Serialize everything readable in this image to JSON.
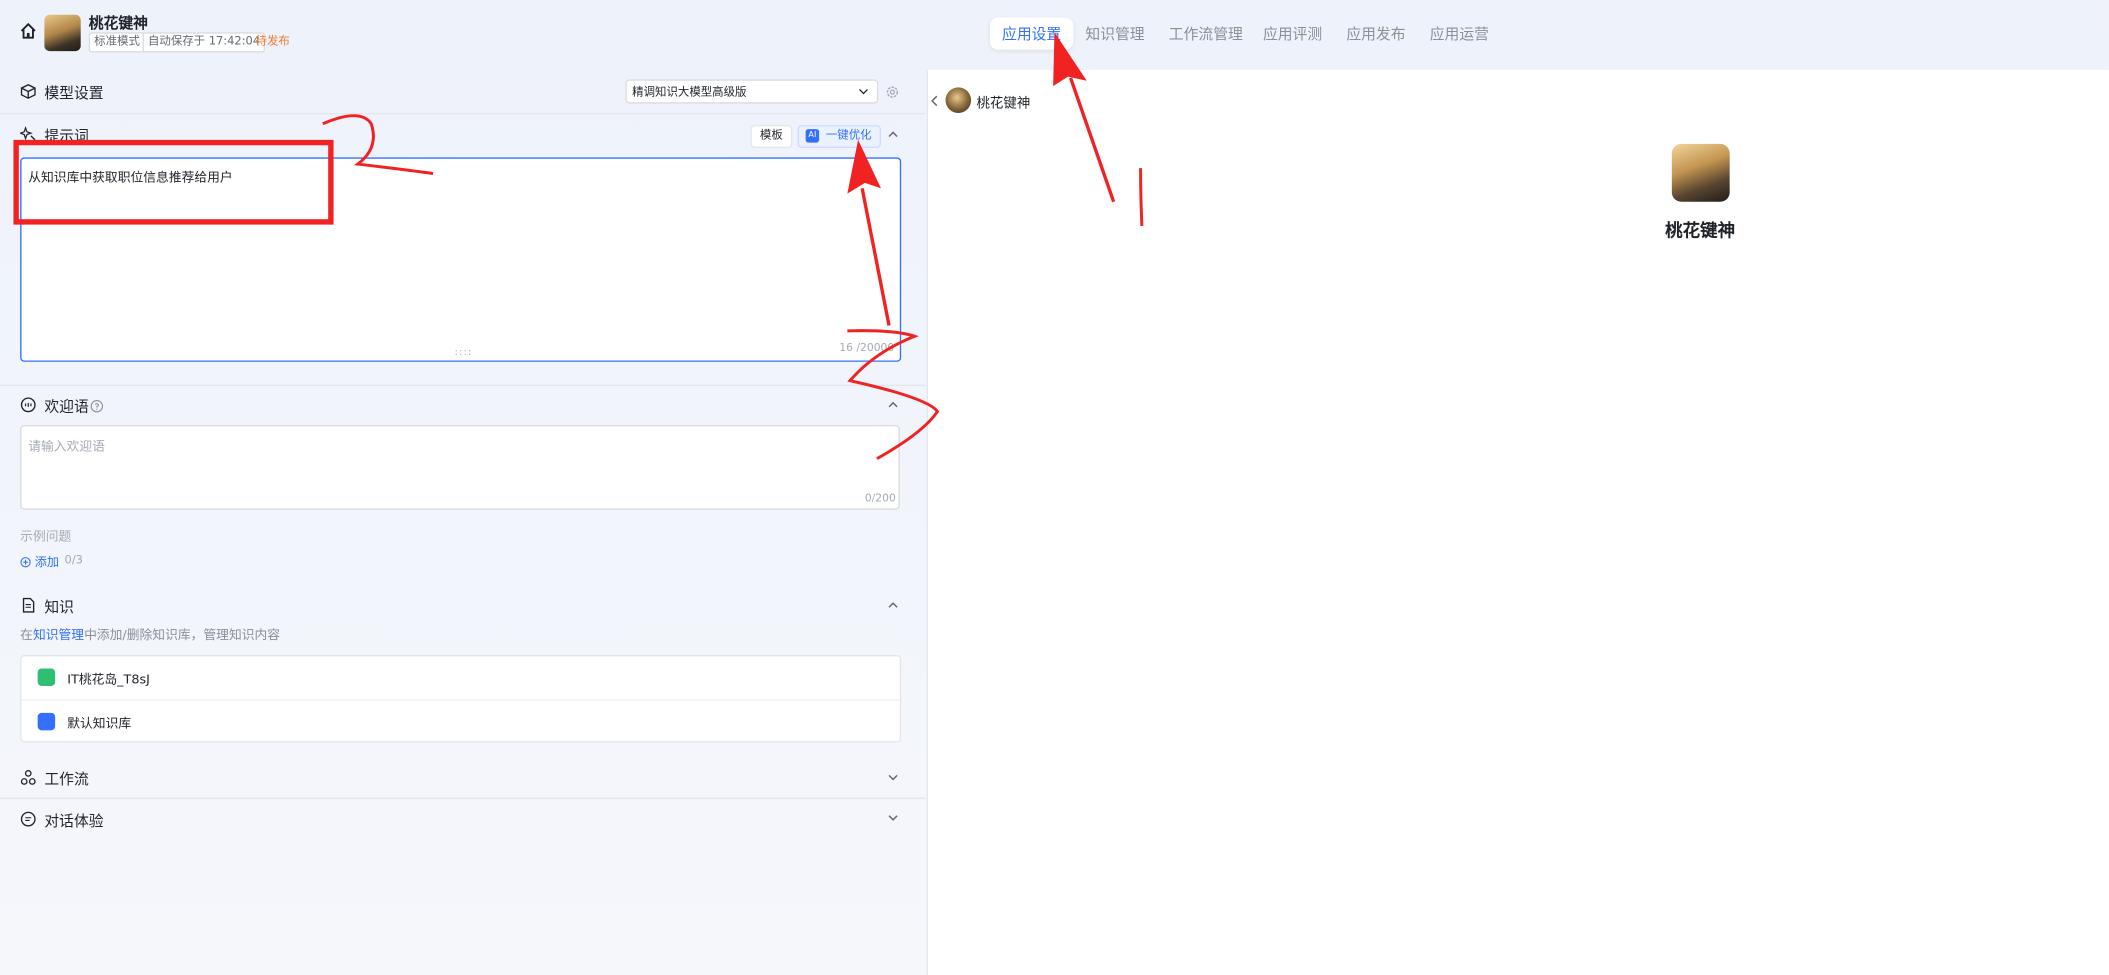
{
  "header": {
    "app_title": "桃花键神",
    "tag_mode": "标准模式",
    "tag_saved": "自动保存于 17:42:04",
    "tag_status": "待发布",
    "tabs": [
      {
        "label": "应用设置",
        "active": true
      },
      {
        "label": "知识管理",
        "active": false
      },
      {
        "label": "工作流管理",
        "active": false
      },
      {
        "label": "应用评测",
        "active": false
      },
      {
        "label": "应用发布",
        "active": false
      },
      {
        "label": "应用运营",
        "active": false
      }
    ]
  },
  "model": {
    "section_label": "模型设置",
    "selected": "精调知识大模型高级版"
  },
  "prompt": {
    "section_label": "提示词",
    "template_label": "模板",
    "optimize_label": "一键优化",
    "ai_badge": "AI",
    "value": "从知识库中获取职位信息推荐给用户",
    "count": "16 /20000"
  },
  "welcome": {
    "section_label": "欢迎语",
    "placeholder": "请输入欢迎语",
    "count": "0/200"
  },
  "examples": {
    "label": "示例问题",
    "add_label": "添加",
    "count": "0/3"
  },
  "knowledge": {
    "section_label": "知识",
    "desc_prefix": "在",
    "desc_link": "知识管理",
    "desc_suffix": "中添加/删除知识库，管理知识内容",
    "items": [
      {
        "name": "IT桃花岛_T8sJ",
        "icon_color": "#2fbf71"
      },
      {
        "name": "默认知识库",
        "icon_color": "#3370ff"
      }
    ]
  },
  "workflow": {
    "section_label": "工作流"
  },
  "dialogue": {
    "section_label": "对话体验"
  },
  "preview": {
    "header_name": "桃花键神",
    "bot_name": "桃花键神"
  },
  "colors": {
    "accent": "#3370ff",
    "annotation": "#f02222",
    "pending": "#f07a2e"
  }
}
